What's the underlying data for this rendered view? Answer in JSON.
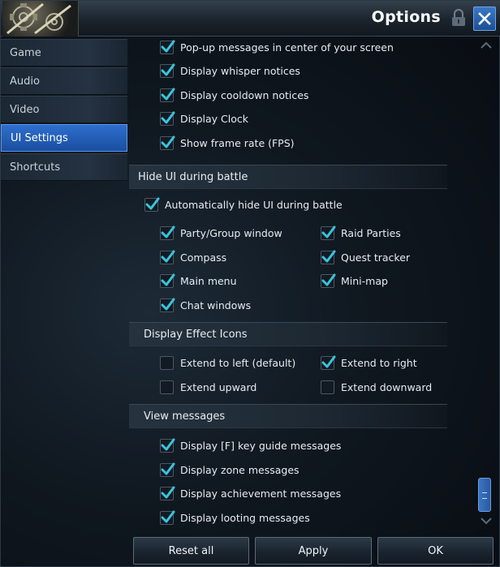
{
  "window": {
    "title": "Options"
  },
  "sidebar": {
    "items": [
      {
        "label": "Game",
        "active": false
      },
      {
        "label": "Audio",
        "active": false
      },
      {
        "label": "Video",
        "active": false
      },
      {
        "label": "UI Settings",
        "active": true
      },
      {
        "label": "Shortcuts",
        "active": false
      }
    ]
  },
  "top_options": [
    {
      "label": "Pop-up messages in center of your screen",
      "checked": true
    },
    {
      "label": "Display whisper notices",
      "checked": true
    },
    {
      "label": "Display cooldown notices",
      "checked": true
    },
    {
      "label": "Display Clock",
      "checked": true
    },
    {
      "label": "Show frame rate (FPS)",
      "checked": true
    }
  ],
  "hide_ui": {
    "header": "Hide UI during battle",
    "master": {
      "label": "Automatically hide UI during battle",
      "checked": true
    },
    "options": [
      {
        "label": "Party/Group window",
        "checked": true
      },
      {
        "label": "Raid Parties",
        "checked": true
      },
      {
        "label": "Compass",
        "checked": true
      },
      {
        "label": "Quest tracker",
        "checked": true
      },
      {
        "label": "Main menu",
        "checked": true
      },
      {
        "label": "Mini-map",
        "checked": true
      },
      {
        "label": "Chat windows",
        "checked": true
      }
    ]
  },
  "effect_icons": {
    "header": "Display Effect Icons",
    "options": [
      {
        "label": "Extend to left (default)",
        "checked": false
      },
      {
        "label": "Extend to right",
        "checked": true
      },
      {
        "label": "Extend upward",
        "checked": false
      },
      {
        "label": "Extend downward",
        "checked": false
      }
    ]
  },
  "view_messages": {
    "header": "View messages",
    "options": [
      {
        "label": "Display [F] key guide messages",
        "checked": true
      },
      {
        "label": "Display zone messages",
        "checked": true
      },
      {
        "label": "Display achievement messages",
        "checked": true
      },
      {
        "label": "Display looting messages",
        "checked": true
      }
    ]
  },
  "footer": {
    "reset_label": "Reset all",
    "apply_label": "Apply",
    "ok_label": "OK"
  },
  "icons": {
    "check": "check-icon",
    "lock": "lock-icon",
    "close": "close-icon",
    "scroll_up": "chevron-up-icon",
    "scroll_down": "chevron-down-icon",
    "emblem": "gear-emblem-icon"
  },
  "colors": {
    "accent": "#2e6fce",
    "check": "#36c6dd",
    "text": "#e6ecf2"
  }
}
